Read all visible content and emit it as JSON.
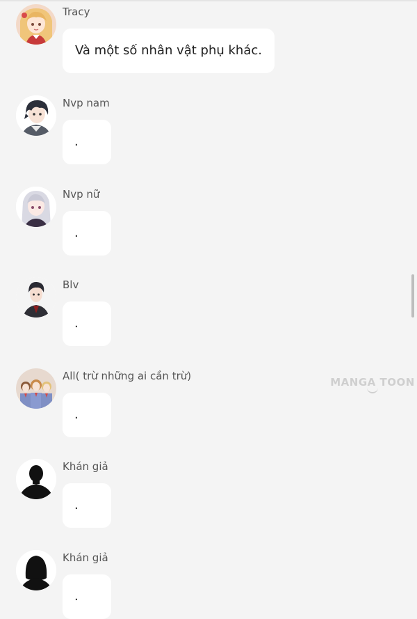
{
  "messages": [
    {
      "name": "Tracy",
      "text": "Và một số nhân vật phụ khác.",
      "avatar_icon": "anime-girl-blonde-avatar-icon"
    },
    {
      "name": "Nvp nam",
      "text": ".",
      "avatar_icon": "anime-boy-dark-hair-avatar-icon"
    },
    {
      "name": "Nvp nữ",
      "text": ".",
      "avatar_icon": "anime-girl-silver-hair-avatar-icon"
    },
    {
      "name": "Blv",
      "text": ".",
      "avatar_icon": "anime-man-suit-avatar-icon"
    },
    {
      "name": "All( trừ những ai cần trừ)",
      "text": ".",
      "avatar_icon": "group-characters-avatar-icon"
    },
    {
      "name": "Khán giả",
      "text": ".",
      "avatar_icon": "male-silhouette-avatar-icon"
    },
    {
      "name": "Khán giả",
      "text": ".",
      "avatar_icon": "female-silhouette-avatar-icon"
    }
  ],
  "watermark": {
    "text": "MANGA TOON"
  },
  "colors": {
    "background": "#f4f4f4",
    "bubble": "#ffffff",
    "name_text": "#555555",
    "watermark": "#cfcfcf"
  }
}
